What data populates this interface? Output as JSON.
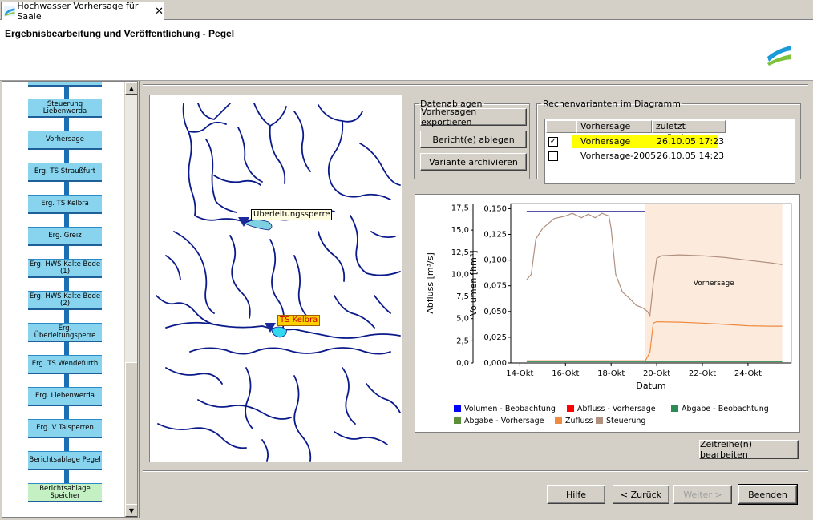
{
  "window": {
    "tab_title": "Hochwasser Vorhersage für Saale",
    "tab_close": "✕"
  },
  "header": {
    "title": "Ergebnisbearbeitung und Veröffentlichung - Pegel"
  },
  "sidebar": {
    "items": [
      {
        "label": "Steuerung Liebenwerda",
        "style": "blue"
      },
      {
        "label": "Vorhersage",
        "style": "blue"
      },
      {
        "label": "Erg. TS Straußfurt",
        "style": "blue"
      },
      {
        "label": "Erg. TS Kelbra",
        "style": "blue"
      },
      {
        "label": "Erg. Greiz",
        "style": "blue"
      },
      {
        "label": "Erg. HWS Kalte Bode (1)",
        "style": "blue"
      },
      {
        "label": "Erg. HWS Kalte Bode (2)",
        "style": "blue"
      },
      {
        "label": "Erg. Überleitungsperre",
        "style": "blue"
      },
      {
        "label": "Erg. TS Wendefurth",
        "style": "blue"
      },
      {
        "label": "Erg. Liebenwerda",
        "style": "blue"
      },
      {
        "label": "Erg. V Talsperren",
        "style": "blue"
      },
      {
        "label": "Berichtsablage Pegel",
        "style": "blue"
      },
      {
        "label": "Berichtsablage Speicher",
        "style": "green"
      }
    ]
  },
  "map": {
    "labels": {
      "station1": "Überleitungssperre",
      "station2": "TS Kelbra"
    },
    "colors": {
      "river": "#0a1a8a",
      "marker": "#1a2a9a",
      "label_bg1": "#fffde0",
      "label_bg2": "#ffd000",
      "label_fg2": "#d00000"
    }
  },
  "datenablagen": {
    "legend": "Datenablagen",
    "buttons": [
      "Vorhersagen exportieren",
      "Bericht(e) ablegen",
      "Variante archivieren"
    ]
  },
  "rechenvarianten": {
    "legend": "Rechenvarianten im Diagramm",
    "columns": [
      "Vorhersage",
      "zuletzt geändert"
    ],
    "rows": [
      {
        "checked": true,
        "name": "Vorhersage",
        "date": "26.10.05 17:23",
        "highlight": "#ffff00"
      },
      {
        "checked": false,
        "name": "Vorhersage-2005",
        "date": "26.10.05 14:23"
      }
    ],
    "check_mark": "✓"
  },
  "chart_data": {
    "type": "line",
    "xlabel": "Datum",
    "ylabel_left": "Abfluss [m³/s]",
    "ylabel_right": "Volumen [hm³]",
    "x_ticks": [
      "14-Okt",
      "16-Okt",
      "18-Okt",
      "20-Okt",
      "22-Okt",
      "24-Okt"
    ],
    "y_left_ticks": [
      "17,5",
      "15,0",
      "12,5",
      "10,0",
      "7,5",
      "5,0",
      "2,5",
      "0,0"
    ],
    "y_right_ticks": [
      "0,150",
      "0,125",
      "0,100",
      "0,075",
      "0,050",
      "0,025",
      "0,000"
    ],
    "ylim_left": [
      0,
      18
    ],
    "xlim_days": [
      13.6,
      25.9
    ],
    "forecast_region": {
      "start": 19.5,
      "end": 25.5,
      "label": "Vorhersage",
      "color": "#fcebdc"
    },
    "legend": [
      {
        "name": "Volumen - Beobachtung",
        "color": "#0000ff"
      },
      {
        "name": "Abfluss - Vorhersage",
        "color": "#ff0000"
      },
      {
        "name": "Abgabe - Beobachtung",
        "color": "#2e8b57"
      },
      {
        "name": "Abgabe - Vorhersage",
        "color": "#5b8f3a"
      },
      {
        "name": "Zufluss",
        "color": "#f08a40"
      },
      {
        "name": "Steuerung",
        "color": "#b09080"
      }
    ],
    "series": [
      {
        "name": "Volumen - Beobachtung",
        "color": "#1a1a8a",
        "points": [
          [
            14.3,
            17.1
          ],
          [
            19.5,
            17.1
          ]
        ]
      },
      {
        "name": "Steuerung",
        "color": "#b09080",
        "points": [
          [
            14.3,
            9.4
          ],
          [
            14.5,
            10.0
          ],
          [
            14.7,
            14.0
          ],
          [
            15.0,
            15.2
          ],
          [
            15.5,
            16.3
          ],
          [
            16.0,
            16.6
          ],
          [
            16.3,
            16.9
          ],
          [
            16.7,
            16.4
          ],
          [
            17.0,
            16.8
          ],
          [
            17.3,
            16.4
          ],
          [
            17.6,
            16.9
          ],
          [
            17.9,
            16.6
          ],
          [
            18.0,
            15.2
          ],
          [
            18.2,
            10.0
          ],
          [
            18.5,
            8.0
          ],
          [
            18.8,
            7.3
          ],
          [
            19.1,
            6.5
          ],
          [
            19.4,
            6.2
          ],
          [
            19.6,
            5.8
          ],
          [
            19.7,
            5.3
          ],
          [
            19.85,
            9.0
          ],
          [
            20.0,
            11.8
          ],
          [
            20.2,
            12.1
          ],
          [
            21.0,
            12.2
          ],
          [
            22.0,
            12.1
          ],
          [
            23.0,
            11.9
          ],
          [
            24.0,
            11.6
          ],
          [
            25.0,
            11.3
          ],
          [
            25.5,
            11.1
          ]
        ]
      },
      {
        "name": "Zufluss",
        "color": "#f08a40",
        "points": [
          [
            14.3,
            0.25
          ],
          [
            19.5,
            0.25
          ],
          [
            19.7,
            1.2
          ],
          [
            19.85,
            4.5
          ],
          [
            20.0,
            4.65
          ],
          [
            21.0,
            4.6
          ],
          [
            22.0,
            4.5
          ],
          [
            23.0,
            4.35
          ],
          [
            24.0,
            4.2
          ],
          [
            25.0,
            4.15
          ],
          [
            25.5,
            4.15
          ]
        ]
      },
      {
        "name": "Abgabe - Beobachtung",
        "color": "#2e8b57",
        "points": [
          [
            14.3,
            0.15
          ],
          [
            25.5,
            0.15
          ]
        ]
      }
    ]
  },
  "actions": {
    "zeitreihe": "Zeitreihe(n) bearbeiten",
    "hilfe": "Hilfe",
    "zurueck": "< Zurück",
    "weiter": "Weiter >",
    "beenden": "Beenden"
  }
}
